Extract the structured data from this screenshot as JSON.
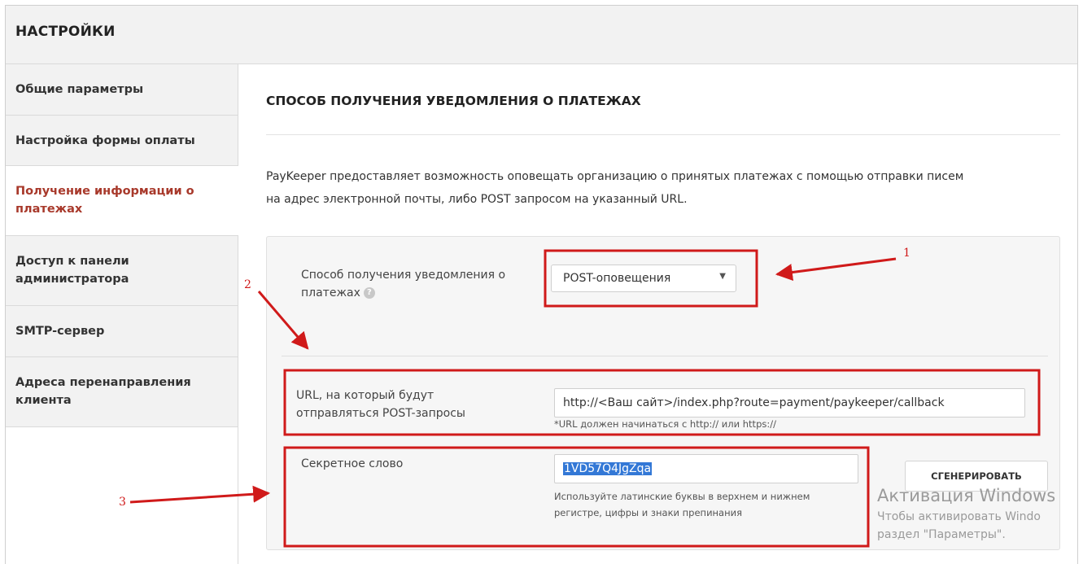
{
  "header": {
    "title": "НАСТРОЙКИ"
  },
  "sidebar": {
    "items": [
      {
        "label": "Общие параметры"
      },
      {
        "label": "Настройка формы оплаты"
      },
      {
        "label": "Получение информации о платежах",
        "line1": "Получение информации о",
        "line2": "платежах",
        "active": true
      },
      {
        "label": "Доступ к панели администратора",
        "line1": "Доступ к панели",
        "line2": "администратора"
      },
      {
        "label": "SMTP-сервер"
      },
      {
        "label": "Адреса перенаправления клиента",
        "line1": "Адреса перенаправления",
        "line2": "клиента"
      }
    ]
  },
  "main": {
    "title": "СПОСОБ ПОЛУЧЕНИЯ УВЕДОМЛЕНИЯ О ПЛАТЕЖАХ",
    "description_line1": "PayKeeper предоставляет возможность оповещать организацию о принятых платежах с помощью отправки писем",
    "description_line2": "на адрес электронной почты, либо POST запросом на указанный URL.",
    "notify_method": {
      "label_line1": "Способ получения уведомления о",
      "label_line2": "платежах",
      "help_icon": "?",
      "selected": "POST-оповещения"
    },
    "url_field": {
      "label_line1": "URL, на который будут",
      "label_line2": "отправляться POST-запросы",
      "value": "http://<Ваш сайт>/index.php?route=payment/paykeeper/callback",
      "hint": "*URL должен начинаться с http:// или https://"
    },
    "secret_field": {
      "label": "Секретное слово",
      "value": "1VD57Q4JgZqa",
      "hint_line1": "Используйте латинские буквы в верхнем и нижнем",
      "hint_line2": "регистре, цифры и знаки препинания",
      "generate_button": "СГЕНЕРИРОВАТЬ"
    }
  },
  "annotations": {
    "n1": "1",
    "n2": "2",
    "n3": "3",
    "color": "#d01a1a"
  },
  "watermark": {
    "line1": "Активация Windows",
    "line2": "Чтобы активировать Windo",
    "line3": "раздел \"Параметры\"."
  }
}
